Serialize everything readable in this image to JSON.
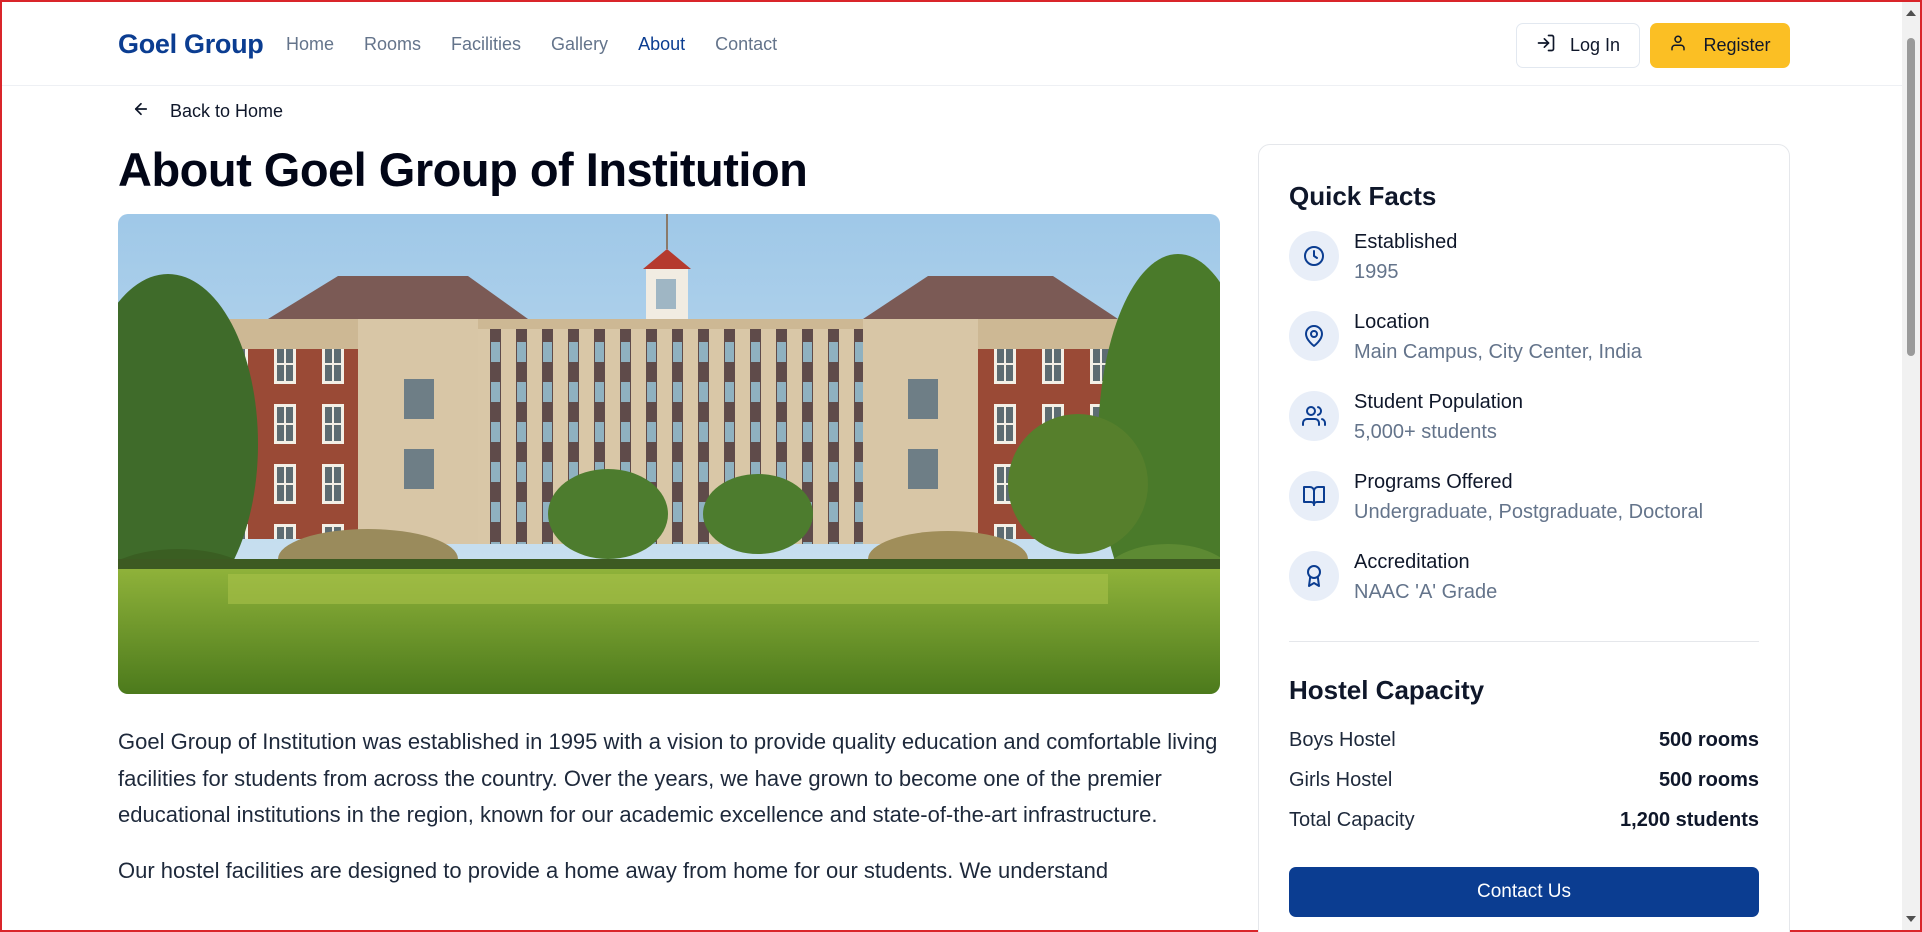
{
  "nav": {
    "brand": "Goel Group",
    "links": [
      "Home",
      "Rooms",
      "Facilities",
      "Gallery",
      "About",
      "Contact"
    ],
    "active": "About",
    "login_label": "Log In",
    "register_label": "Register"
  },
  "main": {
    "back_label": "Back to Home",
    "title": "About Goel Group of Institution",
    "paragraphs": [
      "Goel Group of Institution was established in 1995 with a vision to provide quality education and comfortable living facilities for students from across the country. Over the years, we have grown to become one of the premier educational institutions in the region, known for our academic excellence and state-of-the-art infrastructure.",
      "Our hostel facilities are designed to provide a home away from home for our students. We understand"
    ]
  },
  "sidebar": {
    "quick_facts_title": "Quick Facts",
    "facts": [
      {
        "label": "Established",
        "value": "1995",
        "icon": "clock-icon"
      },
      {
        "label": "Location",
        "value": "Main Campus, City Center, India",
        "icon": "map-pin-icon"
      },
      {
        "label": "Student Population",
        "value": "5,000+ students",
        "icon": "users-icon"
      },
      {
        "label": "Programs Offered",
        "value": "Undergraduate, Postgraduate, Doctoral",
        "icon": "book-open-icon"
      },
      {
        "label": "Accreditation",
        "value": "NAAC 'A' Grade",
        "icon": "award-icon"
      }
    ],
    "capacity_title": "Hostel Capacity",
    "capacity": [
      {
        "name": "Boys Hostel",
        "value": "500 rooms"
      },
      {
        "name": "Girls Hostel",
        "value": "500 rooms"
      },
      {
        "name": "Total Capacity",
        "value": "1,200 students"
      }
    ],
    "contact_label": "Contact Us"
  },
  "colors": {
    "brand": "#0b3d91",
    "accent": "#fbbf24",
    "muted": "#64748b"
  }
}
